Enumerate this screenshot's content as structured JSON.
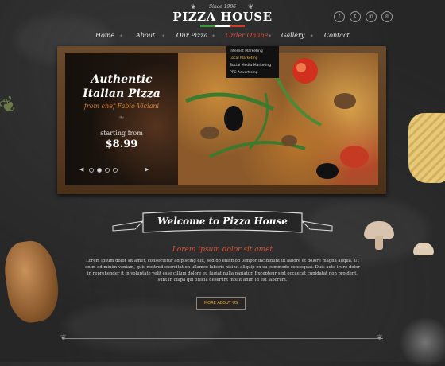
{
  "header": {
    "since": "Since 1986",
    "title": "PIZZA HOUSE",
    "stripe_colors": [
      "#3a9a3a",
      "#ffffff",
      "#d63c2c"
    ],
    "social": [
      {
        "name": "facebook-icon",
        "glyph": "f"
      },
      {
        "name": "twitter-icon",
        "glyph": "t"
      },
      {
        "name": "linkedin-icon",
        "glyph": "in"
      },
      {
        "name": "instagram-icon",
        "glyph": "◎"
      }
    ]
  },
  "nav": {
    "items": [
      "Home",
      "About",
      "Our Pizza",
      "Order Online",
      "Gallery",
      "Contact"
    ],
    "active": "Order Online"
  },
  "dropdown": {
    "items": [
      "Internet Marketing",
      "Local Marketing",
      "Social Media Marketing",
      "PPC Advertising"
    ],
    "selected": "Local Marketing"
  },
  "slider": {
    "title_line1": "Authentic",
    "title_line2": "Italian Pizza",
    "chef": "from chef Fabio Viciani",
    "starting_from": "starting from",
    "price": "$8.99",
    "dot_count": 4,
    "active_dot": 1,
    "prev": "◀",
    "next": "▶"
  },
  "welcome": {
    "title": "Welcome to Pizza House",
    "subtitle": "Lorem ipsum dolor sit amet",
    "body": "Lorem ipsum dolor sit amet, consectetur adipiscing elit, sed do eiusmod tempor incididunt ut labore et dolore magna aliqua. Ut enim ad minim veniam, quis nostrud exercitation ullamco laboris nisi ut aliquip ex ea commodo consequat. Duis aute irure dolor in reprehender it in voluptate velit esse cillum dolore eu fugiat nulla pariatur. Excepteur sint occaecat cupidatat non proident, sunt in culpa qui officia deserunt mollit anim id est laborum.",
    "button": "MORE ABOUT US"
  },
  "colors": {
    "accent": "#d6533d",
    "gold": "#e8b84a",
    "chalkboard": "#262626"
  }
}
